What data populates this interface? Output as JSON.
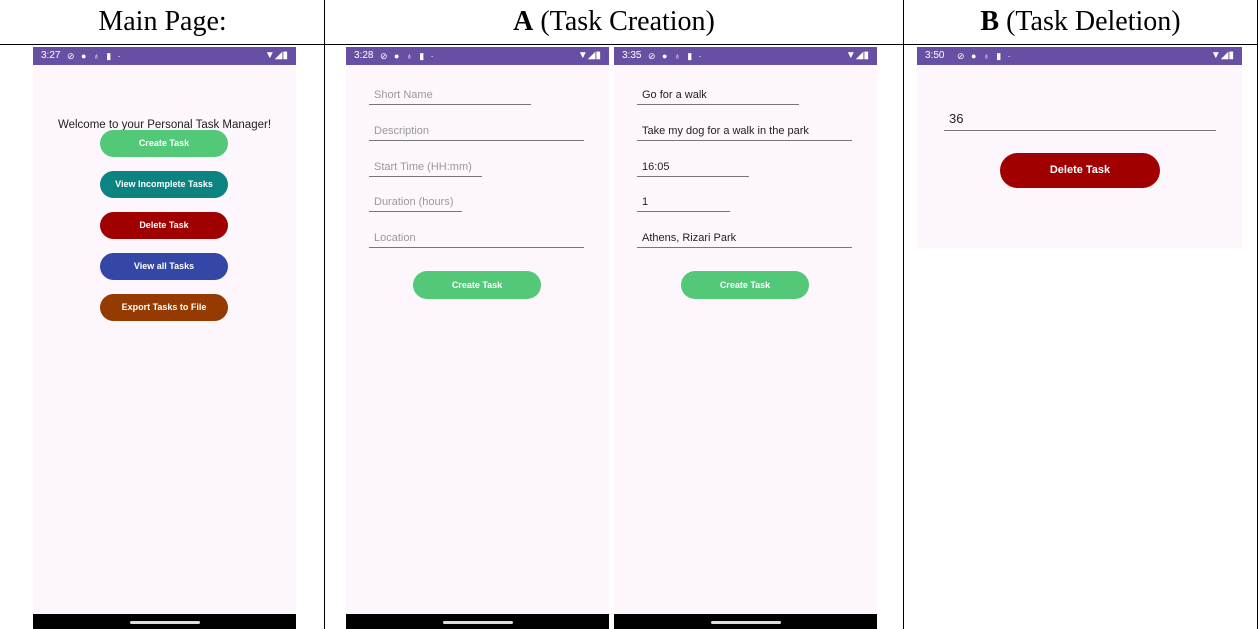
{
  "headers": {
    "main": "Main Page:",
    "a_letter": "A",
    "a_rest": " (Task Creation)",
    "b_letter": "B",
    "b_rest": " (Task Deletion)"
  },
  "status": {
    "main_time": "3:27",
    "a1_time": "3:28",
    "a2_time": "3:35",
    "b_time": "3:50"
  },
  "main_page": {
    "welcome": "Welcome to your Personal Task Manager!",
    "buttons": [
      {
        "label": "Create Task",
        "color": "#52c878"
      },
      {
        "label": "View Incomplete Tasks",
        "color": "#0b8380"
      },
      {
        "label": "Delete Task",
        "color": "#a10000"
      },
      {
        "label": "View all Tasks",
        "color": "#3447a6"
      },
      {
        "label": "Export Tasks to File",
        "color": "#953a00"
      }
    ]
  },
  "create_form_empty": {
    "short_name_placeholder": "Short Name",
    "description_placeholder": "Description",
    "start_time_placeholder": "Start Time (HH:mm)",
    "duration_placeholder": "Duration (hours)",
    "location_placeholder": "Location",
    "submit_label": "Create Task"
  },
  "create_form_filled": {
    "short_name": "Go for a walk",
    "description": "Take my dog for a walk in the park",
    "start_time": "16:05",
    "duration": "1",
    "location": "Athens, Rizari Park",
    "submit_label": "Create Task"
  },
  "delete_form": {
    "task_id": "36",
    "submit_label": "Delete Task",
    "button_color": "#a10000"
  }
}
